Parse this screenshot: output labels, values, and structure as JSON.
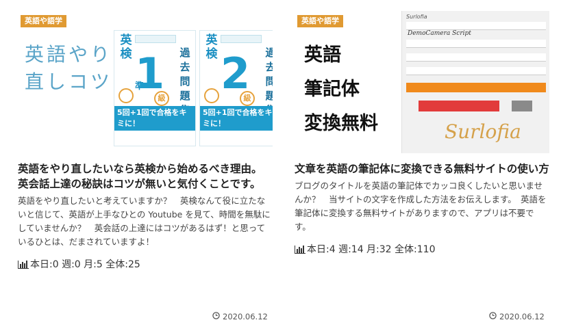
{
  "cards": [
    {
      "badge": "英語や語学",
      "title": "英語をやり直したいなら英検から始めるべき理由。　英会話上達の秘訣はコツが無いと気付くことです。",
      "excerpt": "英語をやり直したいと考えていますか？　英検なんて役に立たないと信じて、英語が上手なひとの Youtube を見て、時間を無駄にしていませんか？　英会話の上達にはコツがあるはず！と思っているひとは、だまされていますよ！",
      "counts": "本日:0 週:0 月:5 全体:25",
      "date": "2020.06.12",
      "thumb": {
        "overlay_text": "英語やり直しコツ",
        "books": [
          {
            "kanji": "英検",
            "number": "1",
            "pre": "準",
            "grade": "級",
            "side": "過去問題集",
            "band": "5回+1回で合格をキミに！"
          },
          {
            "kanji": "英検",
            "number": "2",
            "pre": "",
            "grade": "級",
            "side": "過去問題集",
            "band": "5回+1回で合格をキミに！"
          }
        ]
      }
    },
    {
      "badge": "英語や語学",
      "title": "文章を英語の筆記体に変換できる無料サイトの使い方",
      "excerpt": "ブログのタイトルを英語の筆記体でカッコ良くしたいと思いませんか？　当サイトの文字を作成した方法をお伝えします。　英語を筆記体に変換する無料サイトがありますので、アプリは不要です。",
      "counts": "本日:4 週:14 月:32 全体:110",
      "date": "2020.06.12",
      "thumb": {
        "lines": [
          "英語",
          "筆記体",
          "変換無料"
        ],
        "script_sample": "DemoCamera Script",
        "logo": "Surlofia",
        "signature": "Surlofia"
      }
    }
  ],
  "colors": {
    "badge": "#e09a32",
    "title": "#222222",
    "accent_blue": "#1f9ccc"
  }
}
